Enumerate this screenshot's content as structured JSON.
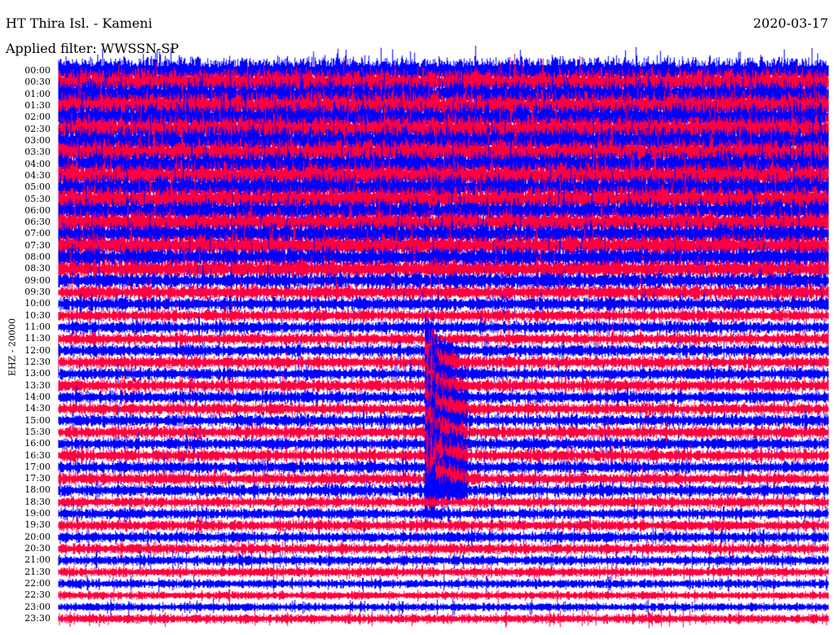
{
  "header": {
    "station": "HT Thira Isl. - Kameni",
    "date": "2020-03-17",
    "filter": "Applied filter: WWSSN-SP"
  },
  "chart_data": {
    "type": "helicorder",
    "title": "HT Thira Isl. - Kameni",
    "ylabel": "EHZ - 20000",
    "row_labels": [
      "00:00",
      "00:30",
      "01:00",
      "01:30",
      "02:00",
      "02:30",
      "03:00",
      "03:30",
      "04:00",
      "04:30",
      "05:00",
      "05:30",
      "06:00",
      "06:30",
      "07:00",
      "07:30",
      "08:00",
      "08:30",
      "09:00",
      "09:30",
      "10:00",
      "10:30",
      "11:00",
      "11:30",
      "12:00",
      "12:30",
      "13:00",
      "13:30",
      "14:00",
      "14:30",
      "15:00",
      "15:30",
      "16:00",
      "16:30",
      "17:00",
      "17:30",
      "18:00",
      "18:30",
      "19:00",
      "19:30",
      "20:00",
      "20:30",
      "21:00",
      "21:30",
      "22:00",
      "22:30",
      "23:00",
      "23:30"
    ],
    "row_minutes": 30,
    "colors": {
      "even_rows": "#0000ff",
      "odd_rows": "#ff0040"
    },
    "relative_noise_amplitude": [
      1.0,
      1.0,
      1.0,
      1.0,
      1.0,
      1.0,
      1.0,
      0.95,
      0.95,
      0.95,
      0.9,
      0.9,
      0.85,
      0.85,
      0.8,
      0.8,
      0.75,
      0.7,
      0.6,
      0.55,
      0.5,
      0.45,
      0.45,
      0.45,
      0.45,
      0.45,
      0.45,
      0.45,
      0.45,
      0.45,
      0.45,
      0.45,
      0.45,
      0.45,
      0.45,
      0.45,
      0.45,
      0.4,
      0.4,
      0.4,
      0.4,
      0.4,
      0.38,
      0.36,
      0.33,
      0.3,
      0.3,
      0.35
    ],
    "event": {
      "start_row_label": "12:00",
      "end_row_label": "18:00",
      "minute_in_row": 14.5,
      "description_visible": false
    }
  }
}
